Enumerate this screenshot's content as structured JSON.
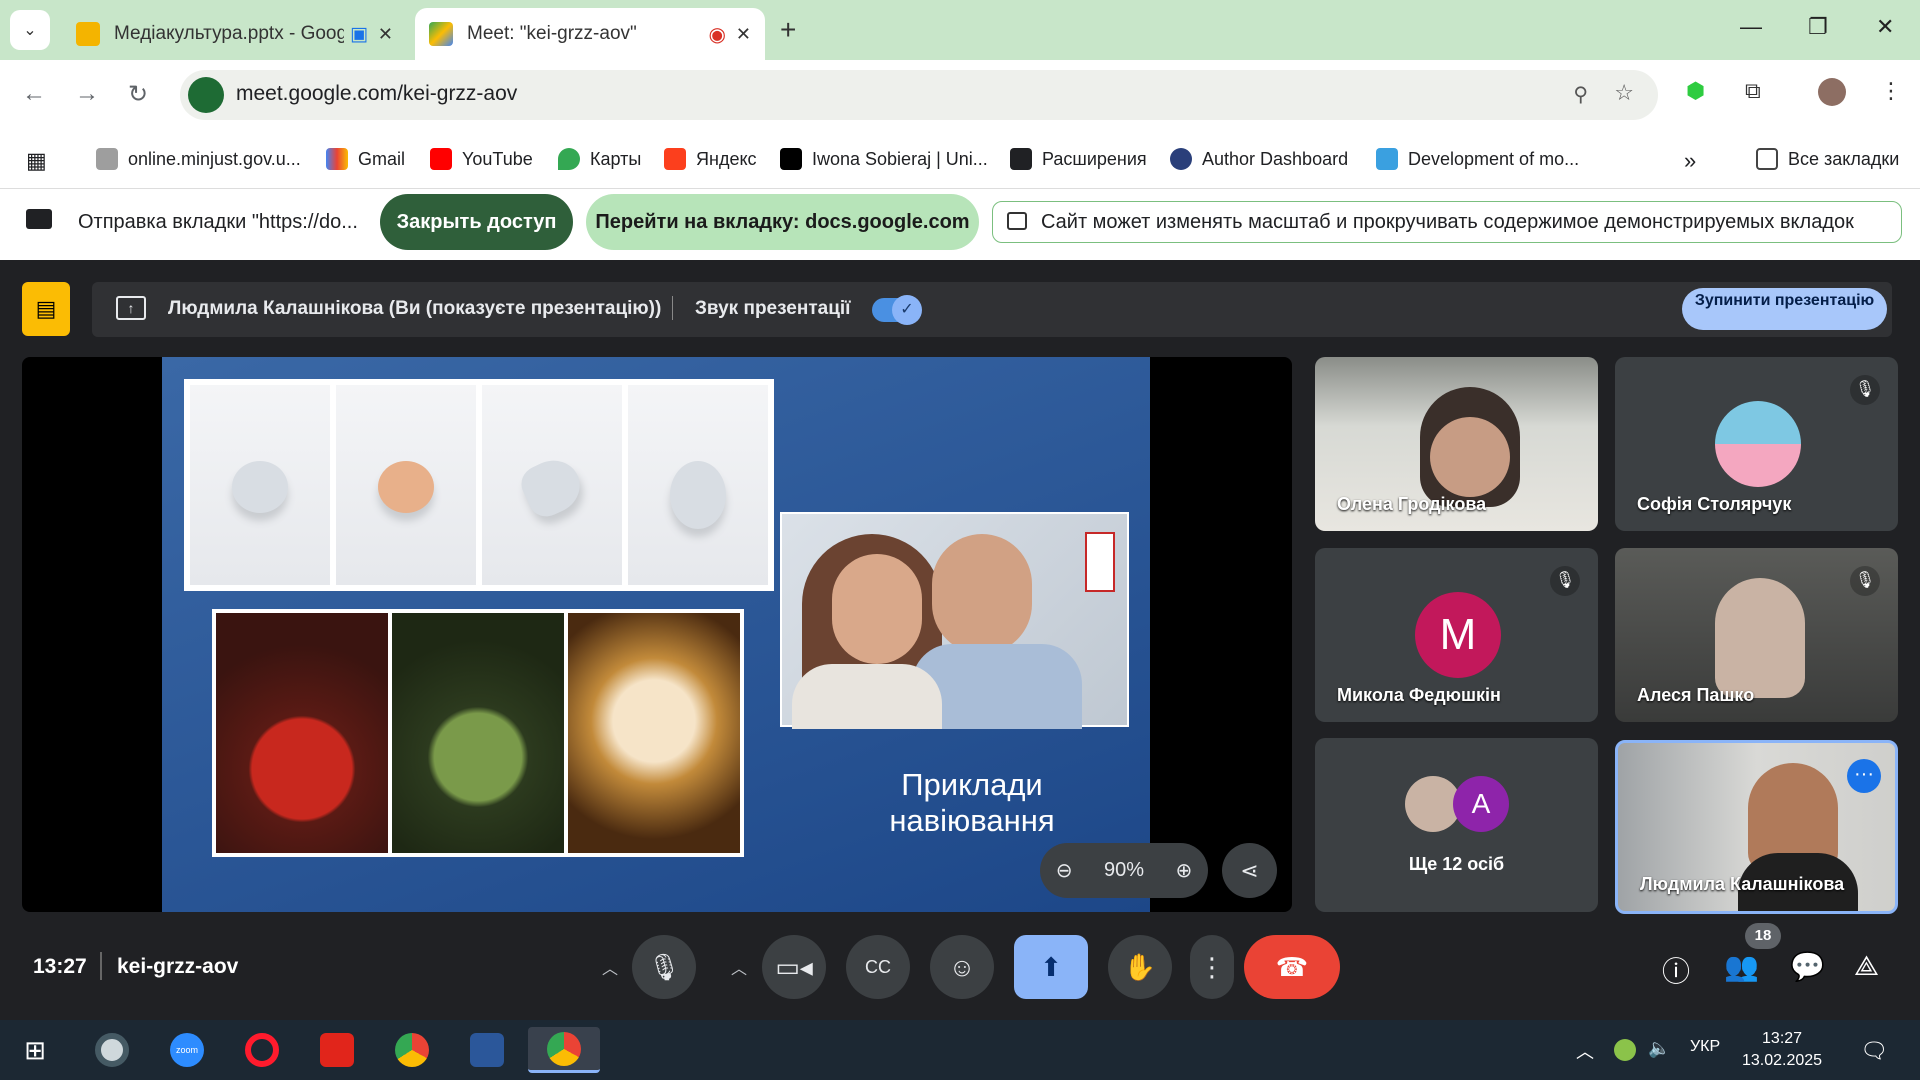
{
  "browser": {
    "tabs": [
      {
        "title": "Медіакультура.pptx - Goog",
        "favicon_color": "#f4b400"
      },
      {
        "title": "Meet: \"kei-grzz-aov\"",
        "favicon_color": "#34a853"
      }
    ],
    "url": "meet.google.com/kei-grzz-aov",
    "bookmarks": [
      {
        "label": "online.minjust.gov.u...",
        "icon": "building-icon"
      },
      {
        "label": "Gmail",
        "icon": "gmail-icon"
      },
      {
        "label": "YouTube",
        "icon": "youtube-icon"
      },
      {
        "label": "Карты",
        "icon": "maps-pin-icon"
      },
      {
        "label": "Яндекс",
        "icon": "yandex-icon"
      },
      {
        "label": "Iwona Sobieraj | Uni...",
        "icon": "academia-icon"
      },
      {
        "label": "Расширения",
        "icon": "puzzle-icon"
      },
      {
        "label": "Author Dashboard",
        "icon": "author-icon"
      },
      {
        "label": "Development of mo...",
        "icon": "dev-icon"
      }
    ],
    "all_bookmarks": "Все закладки"
  },
  "share_bar": {
    "text": "Отправка вкладки \"https://do...",
    "stop_label": "Закрыть доступ",
    "go_label": "Перейти на вкладку: docs.google.com",
    "info": "Сайт может изменять масштаб и прокручивать содержимое демонстрируемых вкладок"
  },
  "presenting": {
    "name": "Людмила Калашнікова (Ви (показуєте презентацію))",
    "sound_label": "Звук презентації",
    "sound_on": true,
    "stop_label": "Зупинити презентацію"
  },
  "slide": {
    "caption": "Приклади навіювання",
    "zoom": "90%"
  },
  "participants": [
    {
      "name": "Олена Гродікова",
      "muted": false,
      "type": "video"
    },
    {
      "name": "Софія Столярчук",
      "muted": true,
      "type": "avatar-image"
    },
    {
      "name": "Микола Федюшкін",
      "muted": true,
      "type": "letter",
      "letter": "M",
      "color": "#c2185b"
    },
    {
      "name": "Алеся Пашко",
      "muted": true,
      "type": "video"
    },
    {
      "name": "Ще 12 осіб",
      "type": "more",
      "letter": "A"
    },
    {
      "name": "Людмила Калашнікова",
      "type": "video-self"
    }
  ],
  "meeting": {
    "time": "13:27",
    "code": "kei-grzz-aov",
    "people_count": "18"
  },
  "taskbar": {
    "lang": "УКР",
    "time": "13:27",
    "date": "13.02.2025",
    "zoom_label": "zoom"
  }
}
